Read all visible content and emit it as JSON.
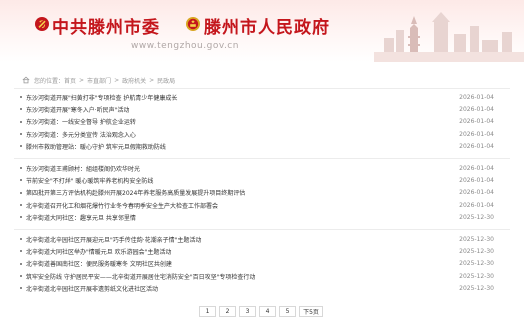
{
  "header": {
    "party_title": "中共滕州市委",
    "gov_title": "滕州市人民政府",
    "domain": "www.tengzhou.gov.cn",
    "accent": "#c4161c"
  },
  "breadcrumb": {
    "home_icon": "home-icon",
    "items": [
      "您的位置：首页",
      "市直部门",
      "政府机关",
      "民政局"
    ],
    "separator": ">"
  },
  "news_groups": [
    [
      {
        "title": "东沙河街道开展\"扫黄打非\"专项检查 护航青少年健康成长",
        "date": "2026-01-04"
      },
      {
        "title": "东沙河街道开展\"寒冬入户·听民声\"活动",
        "date": "2026-01-04"
      },
      {
        "title": "东沙河街道：一线安全督导 护航企业运转",
        "date": "2026-01-04"
      },
      {
        "title": "东沙河街道：多元分类宣传 法治观念入心",
        "date": "2026-01-04"
      },
      {
        "title": "滕州市救助管理站：暖心守护 筑牢元旦假期救助防线",
        "date": "2026-01-04"
      }
    ],
    [
      {
        "title": "东沙河街道王甫顾村：組组楼阁仍欢华时光",
        "date": "2026-01-04"
      },
      {
        "title": "节前安全\"不打烊\" 暖心暖筑牢养老机构安全防线",
        "date": "2026-01-04"
      },
      {
        "title": "第四批开第三方评估机构赴滕州开展2024年养老服务高质量发展提升项目终期评估",
        "date": "2026-01-04"
      },
      {
        "title": "北辛街道召开化工和烟花爆竹行业冬今春明季安全生产大检查工作部署会",
        "date": "2026-01-04"
      },
      {
        "title": "北辛街道大同社区：趣享元旦 共享邻里情",
        "date": "2025-12-30"
      }
    ],
    [
      {
        "title": "北辛街道北辛园社区开展迎元旦\"巧手传佳韵·花潮亲子情\"主题活动",
        "date": "2025-12-30"
      },
      {
        "title": "北辛街道大同社区举办\"情暖元旦 欢乐游园会\"主题活动",
        "date": "2025-12-30"
      },
      {
        "title": "北辛街道善国南社区：便民服务暖寒冬 文明社区共创建",
        "date": "2025-12-30"
      },
      {
        "title": "筑牢安全防线 守护居民平安——北辛街道开展居住宅消防安全\"百日攻坚\"专项检查行动",
        "date": "2025-12-30"
      },
      {
        "title": "北辛街道北辛园社区开展非遗剪纸文化进社区活动",
        "date": "2025-12-30"
      }
    ]
  ],
  "pagination": {
    "pages": [
      "1",
      "2",
      "3",
      "4",
      "5"
    ],
    "next_label": "下5页"
  }
}
